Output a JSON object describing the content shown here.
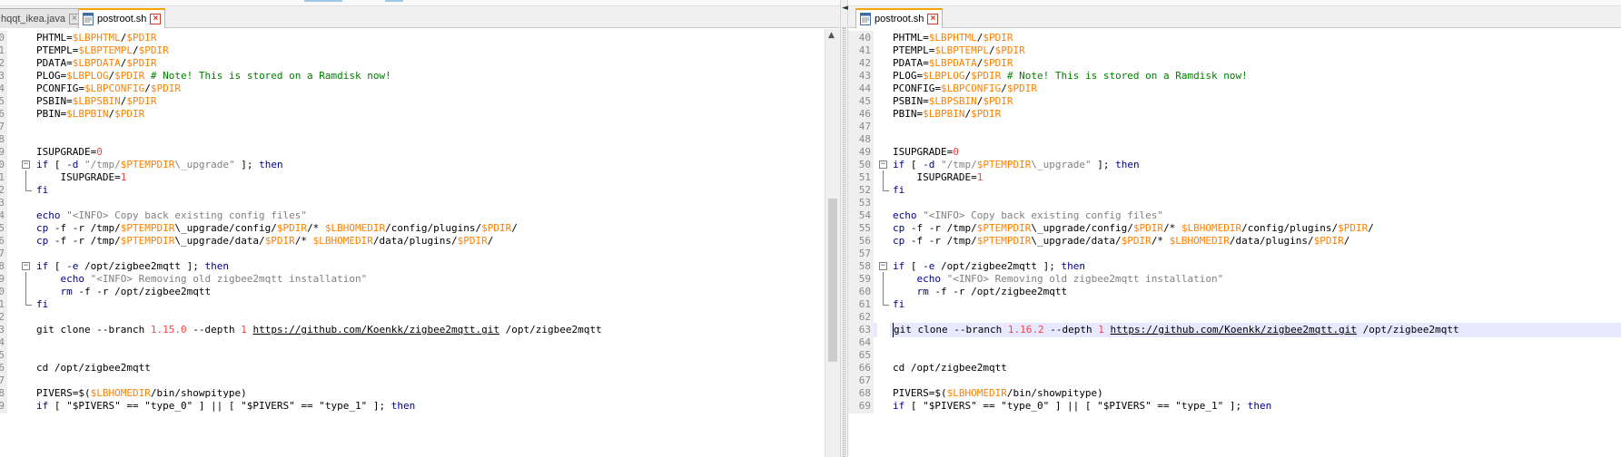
{
  "colors": {
    "variable": "#ff8000",
    "keyword": "#00008b",
    "string": "#808080",
    "number": "#ff4040",
    "comment": "#008000",
    "active_tab_top": "#f7a400",
    "line_highlight": "#e8e8ff"
  },
  "left_pane": {
    "tabs": [
      {
        "label": "hqqt_ikea.java",
        "active": false,
        "icon": "file-icon"
      },
      {
        "label": "postroot.sh",
        "active": true,
        "icon": "file-icon"
      }
    ],
    "scroll_position": 0.62
  },
  "right_pane": {
    "tabs": [
      {
        "label": "postroot.sh",
        "active": true,
        "icon": "file-icon"
      }
    ],
    "scroll_position": 0.62
  },
  "left_lines": [
    {
      "num": "0",
      "fold": "",
      "tokens": [
        [
          "",
          "PHTML="
        ],
        [
          "var",
          "$LBPHTML"
        ],
        [
          "",
          "/"
        ],
        [
          "var",
          "$PDIR"
        ]
      ]
    },
    {
      "num": "1",
      "fold": "",
      "tokens": [
        [
          "",
          "PTEMPL="
        ],
        [
          "var",
          "$LBPTEMPL"
        ],
        [
          "",
          "/"
        ],
        [
          "var",
          "$PDIR"
        ]
      ]
    },
    {
      "num": "2",
      "fold": "",
      "tokens": [
        [
          "",
          "PDATA="
        ],
        [
          "var",
          "$LBPDATA"
        ],
        [
          "",
          "/"
        ],
        [
          "var",
          "$PDIR"
        ]
      ]
    },
    {
      "num": "3",
      "fold": "",
      "tokens": [
        [
          "",
          "PLOG="
        ],
        [
          "var",
          "$LBPLOG"
        ],
        [
          "",
          "/"
        ],
        [
          "var",
          "$PDIR"
        ],
        [
          "cmt",
          " # Note! This is stored on a Ramdisk now!"
        ]
      ]
    },
    {
      "num": "4",
      "fold": "",
      "tokens": [
        [
          "",
          "PCONFIG="
        ],
        [
          "var",
          "$LBPCONFIG"
        ],
        [
          "",
          "/"
        ],
        [
          "var",
          "$PDIR"
        ]
      ]
    },
    {
      "num": "5",
      "fold": "",
      "tokens": [
        [
          "",
          "PSBIN="
        ],
        [
          "var",
          "$LBPSBIN"
        ],
        [
          "",
          "/"
        ],
        [
          "var",
          "$PDIR"
        ]
      ]
    },
    {
      "num": "6",
      "fold": "",
      "tokens": [
        [
          "",
          "PBIN="
        ],
        [
          "var",
          "$LBPBIN"
        ],
        [
          "",
          "/"
        ],
        [
          "var",
          "$PDIR"
        ]
      ]
    },
    {
      "num": "7",
      "fold": "",
      "tokens": []
    },
    {
      "num": "8",
      "fold": "",
      "tokens": []
    },
    {
      "num": "9",
      "fold": "",
      "tokens": [
        [
          "",
          "ISUPGRADE="
        ],
        [
          "num",
          "0"
        ]
      ]
    },
    {
      "num": "0",
      "fold": "open",
      "tokens": [
        [
          "kw",
          "if"
        ],
        [
          "",
          " [ "
        ],
        [
          "kw",
          "-d"
        ],
        [
          "",
          " "
        ],
        [
          "str",
          "\"/tmp/"
        ],
        [
          "var",
          "$PTEMPDIR"
        ],
        [
          "str",
          "\\_upgrade\""
        ],
        [
          "",
          " ]; "
        ],
        [
          "kw",
          "then"
        ]
      ]
    },
    {
      "num": "1",
      "fold": "line",
      "tokens": [
        [
          "",
          "    ISUPGRADE="
        ],
        [
          "num",
          "1"
        ]
      ]
    },
    {
      "num": "2",
      "fold": "end",
      "tokens": [
        [
          "kw",
          "fi"
        ]
      ]
    },
    {
      "num": "3",
      "fold": "",
      "tokens": []
    },
    {
      "num": "4",
      "fold": "",
      "tokens": [
        [
          "kw",
          "echo"
        ],
        [
          "",
          " "
        ],
        [
          "str",
          "\"<INFO> Copy back existing config files\""
        ]
      ]
    },
    {
      "num": "5",
      "fold": "",
      "tokens": [
        [
          "kw",
          "cp"
        ],
        [
          "",
          " -f -r /tmp/"
        ],
        [
          "var",
          "$PTEMPDIR"
        ],
        [
          "",
          "\\_upgrade/config/"
        ],
        [
          "var",
          "$PDIR"
        ],
        [
          "",
          "/* "
        ],
        [
          "var",
          "$LBHOMEDIR"
        ],
        [
          "",
          "/config/plugins/"
        ],
        [
          "var",
          "$PDIR"
        ],
        [
          "",
          "/"
        ]
      ]
    },
    {
      "num": "6",
      "fold": "",
      "tokens": [
        [
          "kw",
          "cp"
        ],
        [
          "",
          " -f -r /tmp/"
        ],
        [
          "var",
          "$PTEMPDIR"
        ],
        [
          "",
          "\\_upgrade/data/"
        ],
        [
          "var",
          "$PDIR"
        ],
        [
          "",
          "/* "
        ],
        [
          "var",
          "$LBHOMEDIR"
        ],
        [
          "",
          "/data/plugins/"
        ],
        [
          "var",
          "$PDIR"
        ],
        [
          "",
          "/"
        ]
      ]
    },
    {
      "num": "7",
      "fold": "",
      "tokens": []
    },
    {
      "num": "8",
      "fold": "open",
      "tokens": [
        [
          "kw",
          "if"
        ],
        [
          "",
          " [ "
        ],
        [
          "kw",
          "-e"
        ],
        [
          "",
          " /opt/zigbee2mqtt ]; "
        ],
        [
          "kw",
          "then"
        ]
      ]
    },
    {
      "num": "9",
      "fold": "line",
      "tokens": [
        [
          "",
          "    "
        ],
        [
          "kw",
          "echo"
        ],
        [
          "",
          " "
        ],
        [
          "str",
          "\"<INFO> Removing old zigbee2mqtt installation\""
        ]
      ]
    },
    {
      "num": "0",
      "fold": "line",
      "tokens": [
        [
          "",
          "    "
        ],
        [
          "kw",
          "rm"
        ],
        [
          "",
          " -f -r /opt/zigbee2mqtt"
        ]
      ]
    },
    {
      "num": "1",
      "fold": "end",
      "tokens": [
        [
          "kw",
          "fi"
        ]
      ]
    },
    {
      "num": "2",
      "fold": "",
      "tokens": []
    },
    {
      "num": "3",
      "fold": "",
      "tokens": [
        [
          "",
          "git clone --branch "
        ],
        [
          "num",
          "1.15.0"
        ],
        [
          "",
          " --depth "
        ],
        [
          "num",
          "1"
        ],
        [
          "",
          " "
        ],
        [
          "url",
          "https://github.com/Koenkk/zigbee2mqtt.git"
        ],
        [
          "",
          " /opt/zigbee2mqtt"
        ]
      ]
    },
    {
      "num": "4",
      "fold": "",
      "tokens": []
    },
    {
      "num": "5",
      "fold": "",
      "tokens": []
    },
    {
      "num": "6",
      "fold": "",
      "tokens": [
        [
          "",
          "cd /opt/zigbee2mqtt"
        ]
      ]
    },
    {
      "num": "7",
      "fold": "",
      "tokens": []
    },
    {
      "num": "8",
      "fold": "",
      "tokens": [
        [
          "",
          "PIVERS=$("
        ],
        [
          "var",
          "$LBHOMEDIR"
        ],
        [
          "",
          "/bin/showpitype)"
        ]
      ]
    },
    {
      "num": "9",
      "fold": "",
      "tokens": [
        [
          "kw",
          "if"
        ],
        [
          "",
          " [ \"$PIVERS\" == \"type_0\" ] || [ \"$PIVERS\" == \"type_1\" ]; "
        ],
        [
          "kw",
          "then"
        ]
      ]
    }
  ],
  "right_lines": [
    {
      "num": "40",
      "fold": "",
      "tokens": [
        [
          "",
          "PHTML="
        ],
        [
          "var",
          "$LBPHTML"
        ],
        [
          "",
          "/"
        ],
        [
          "var",
          "$PDIR"
        ]
      ]
    },
    {
      "num": "41",
      "fold": "",
      "tokens": [
        [
          "",
          "PTEMPL="
        ],
        [
          "var",
          "$LBPTEMPL"
        ],
        [
          "",
          "/"
        ],
        [
          "var",
          "$PDIR"
        ]
      ]
    },
    {
      "num": "42",
      "fold": "",
      "tokens": [
        [
          "",
          "PDATA="
        ],
        [
          "var",
          "$LBPDATA"
        ],
        [
          "",
          "/"
        ],
        [
          "var",
          "$PDIR"
        ]
      ]
    },
    {
      "num": "43",
      "fold": "",
      "tokens": [
        [
          "",
          "PLOG="
        ],
        [
          "var",
          "$LBPLOG"
        ],
        [
          "",
          "/"
        ],
        [
          "var",
          "$PDIR"
        ],
        [
          "cmt",
          " # Note! This is stored on a Ramdisk now!"
        ]
      ]
    },
    {
      "num": "44",
      "fold": "",
      "tokens": [
        [
          "",
          "PCONFIG="
        ],
        [
          "var",
          "$LBPCONFIG"
        ],
        [
          "",
          "/"
        ],
        [
          "var",
          "$PDIR"
        ]
      ]
    },
    {
      "num": "45",
      "fold": "",
      "tokens": [
        [
          "",
          "PSBIN="
        ],
        [
          "var",
          "$LBPSBIN"
        ],
        [
          "",
          "/"
        ],
        [
          "var",
          "$PDIR"
        ]
      ]
    },
    {
      "num": "46",
      "fold": "",
      "tokens": [
        [
          "",
          "PBIN="
        ],
        [
          "var",
          "$LBPBIN"
        ],
        [
          "",
          "/"
        ],
        [
          "var",
          "$PDIR"
        ]
      ]
    },
    {
      "num": "47",
      "fold": "",
      "tokens": []
    },
    {
      "num": "48",
      "fold": "",
      "tokens": []
    },
    {
      "num": "49",
      "fold": "",
      "tokens": [
        [
          "",
          "ISUPGRADE="
        ],
        [
          "num",
          "0"
        ]
      ]
    },
    {
      "num": "50",
      "fold": "open",
      "tokens": [
        [
          "kw",
          "if"
        ],
        [
          "",
          " [ "
        ],
        [
          "kw",
          "-d"
        ],
        [
          "",
          " "
        ],
        [
          "str",
          "\"/tmp/"
        ],
        [
          "var",
          "$PTEMPDIR"
        ],
        [
          "str",
          "\\_upgrade\""
        ],
        [
          "",
          " ]; "
        ],
        [
          "kw",
          "then"
        ]
      ]
    },
    {
      "num": "51",
      "fold": "line",
      "tokens": [
        [
          "",
          "    ISUPGRADE="
        ],
        [
          "num",
          "1"
        ]
      ]
    },
    {
      "num": "52",
      "fold": "end",
      "tokens": [
        [
          "kw",
          "fi"
        ]
      ]
    },
    {
      "num": "53",
      "fold": "",
      "tokens": []
    },
    {
      "num": "54",
      "fold": "",
      "tokens": [
        [
          "kw",
          "echo"
        ],
        [
          "",
          " "
        ],
        [
          "str",
          "\"<INFO> Copy back existing config files\""
        ]
      ]
    },
    {
      "num": "55",
      "fold": "",
      "tokens": [
        [
          "kw",
          "cp"
        ],
        [
          "",
          " -f -r /tmp/"
        ],
        [
          "var",
          "$PTEMPDIR"
        ],
        [
          "",
          "\\_upgrade/config/"
        ],
        [
          "var",
          "$PDIR"
        ],
        [
          "",
          "/* "
        ],
        [
          "var",
          "$LBHOMEDIR"
        ],
        [
          "",
          "/config/plugins/"
        ],
        [
          "var",
          "$PDIR"
        ],
        [
          "",
          "/"
        ]
      ]
    },
    {
      "num": "56",
      "fold": "",
      "tokens": [
        [
          "kw",
          "cp"
        ],
        [
          "",
          " -f -r /tmp/"
        ],
        [
          "var",
          "$PTEMPDIR"
        ],
        [
          "",
          "\\_upgrade/data/"
        ],
        [
          "var",
          "$PDIR"
        ],
        [
          "",
          "/* "
        ],
        [
          "var",
          "$LBHOMEDIR"
        ],
        [
          "",
          "/data/plugins/"
        ],
        [
          "var",
          "$PDIR"
        ],
        [
          "",
          "/"
        ]
      ]
    },
    {
      "num": "57",
      "fold": "",
      "tokens": []
    },
    {
      "num": "58",
      "fold": "open",
      "tokens": [
        [
          "kw",
          "if"
        ],
        [
          "",
          " [ "
        ],
        [
          "kw",
          "-e"
        ],
        [
          "",
          " /opt/zigbee2mqtt ]; "
        ],
        [
          "kw",
          "then"
        ]
      ]
    },
    {
      "num": "59",
      "fold": "line",
      "tokens": [
        [
          "",
          "    "
        ],
        [
          "kw",
          "echo"
        ],
        [
          "",
          " "
        ],
        [
          "str",
          "\"<INFO> Removing old zigbee2mqtt installation\""
        ]
      ]
    },
    {
      "num": "60",
      "fold": "line",
      "tokens": [
        [
          "",
          "    "
        ],
        [
          "kw",
          "rm"
        ],
        [
          "",
          " -f -r /opt/zigbee2mqtt"
        ]
      ]
    },
    {
      "num": "61",
      "fold": "end",
      "tokens": [
        [
          "kw",
          "fi"
        ]
      ]
    },
    {
      "num": "62",
      "fold": "",
      "tokens": []
    },
    {
      "num": "63",
      "fold": "",
      "highlight": true,
      "tokens": [
        [
          "",
          "git clone --branch "
        ],
        [
          "num",
          "1.16.2"
        ],
        [
          "",
          " --depth "
        ],
        [
          "num",
          "1"
        ],
        [
          "",
          " "
        ],
        [
          "url",
          "https://github.com/Koenkk/zigbee2mqtt.git"
        ],
        [
          "",
          " /opt/zigbee2mqtt"
        ]
      ]
    },
    {
      "num": "64",
      "fold": "",
      "tokens": []
    },
    {
      "num": "65",
      "fold": "",
      "tokens": []
    },
    {
      "num": "66",
      "fold": "",
      "tokens": [
        [
          "",
          "cd /opt/zigbee2mqtt"
        ]
      ]
    },
    {
      "num": "67",
      "fold": "",
      "tokens": []
    },
    {
      "num": "68",
      "fold": "",
      "tokens": [
        [
          "",
          "PIVERS=$("
        ],
        [
          "var",
          "$LBHOMEDIR"
        ],
        [
          "",
          "/bin/showpitype)"
        ]
      ]
    },
    {
      "num": "69",
      "fold": "",
      "tokens": [
        [
          "kw",
          "if"
        ],
        [
          "",
          " [ \"$PIVERS\" == \"type_0\" ] || [ \"$PIVERS\" == \"type_1\" ]; "
        ],
        [
          "kw",
          "then"
        ]
      ]
    }
  ]
}
